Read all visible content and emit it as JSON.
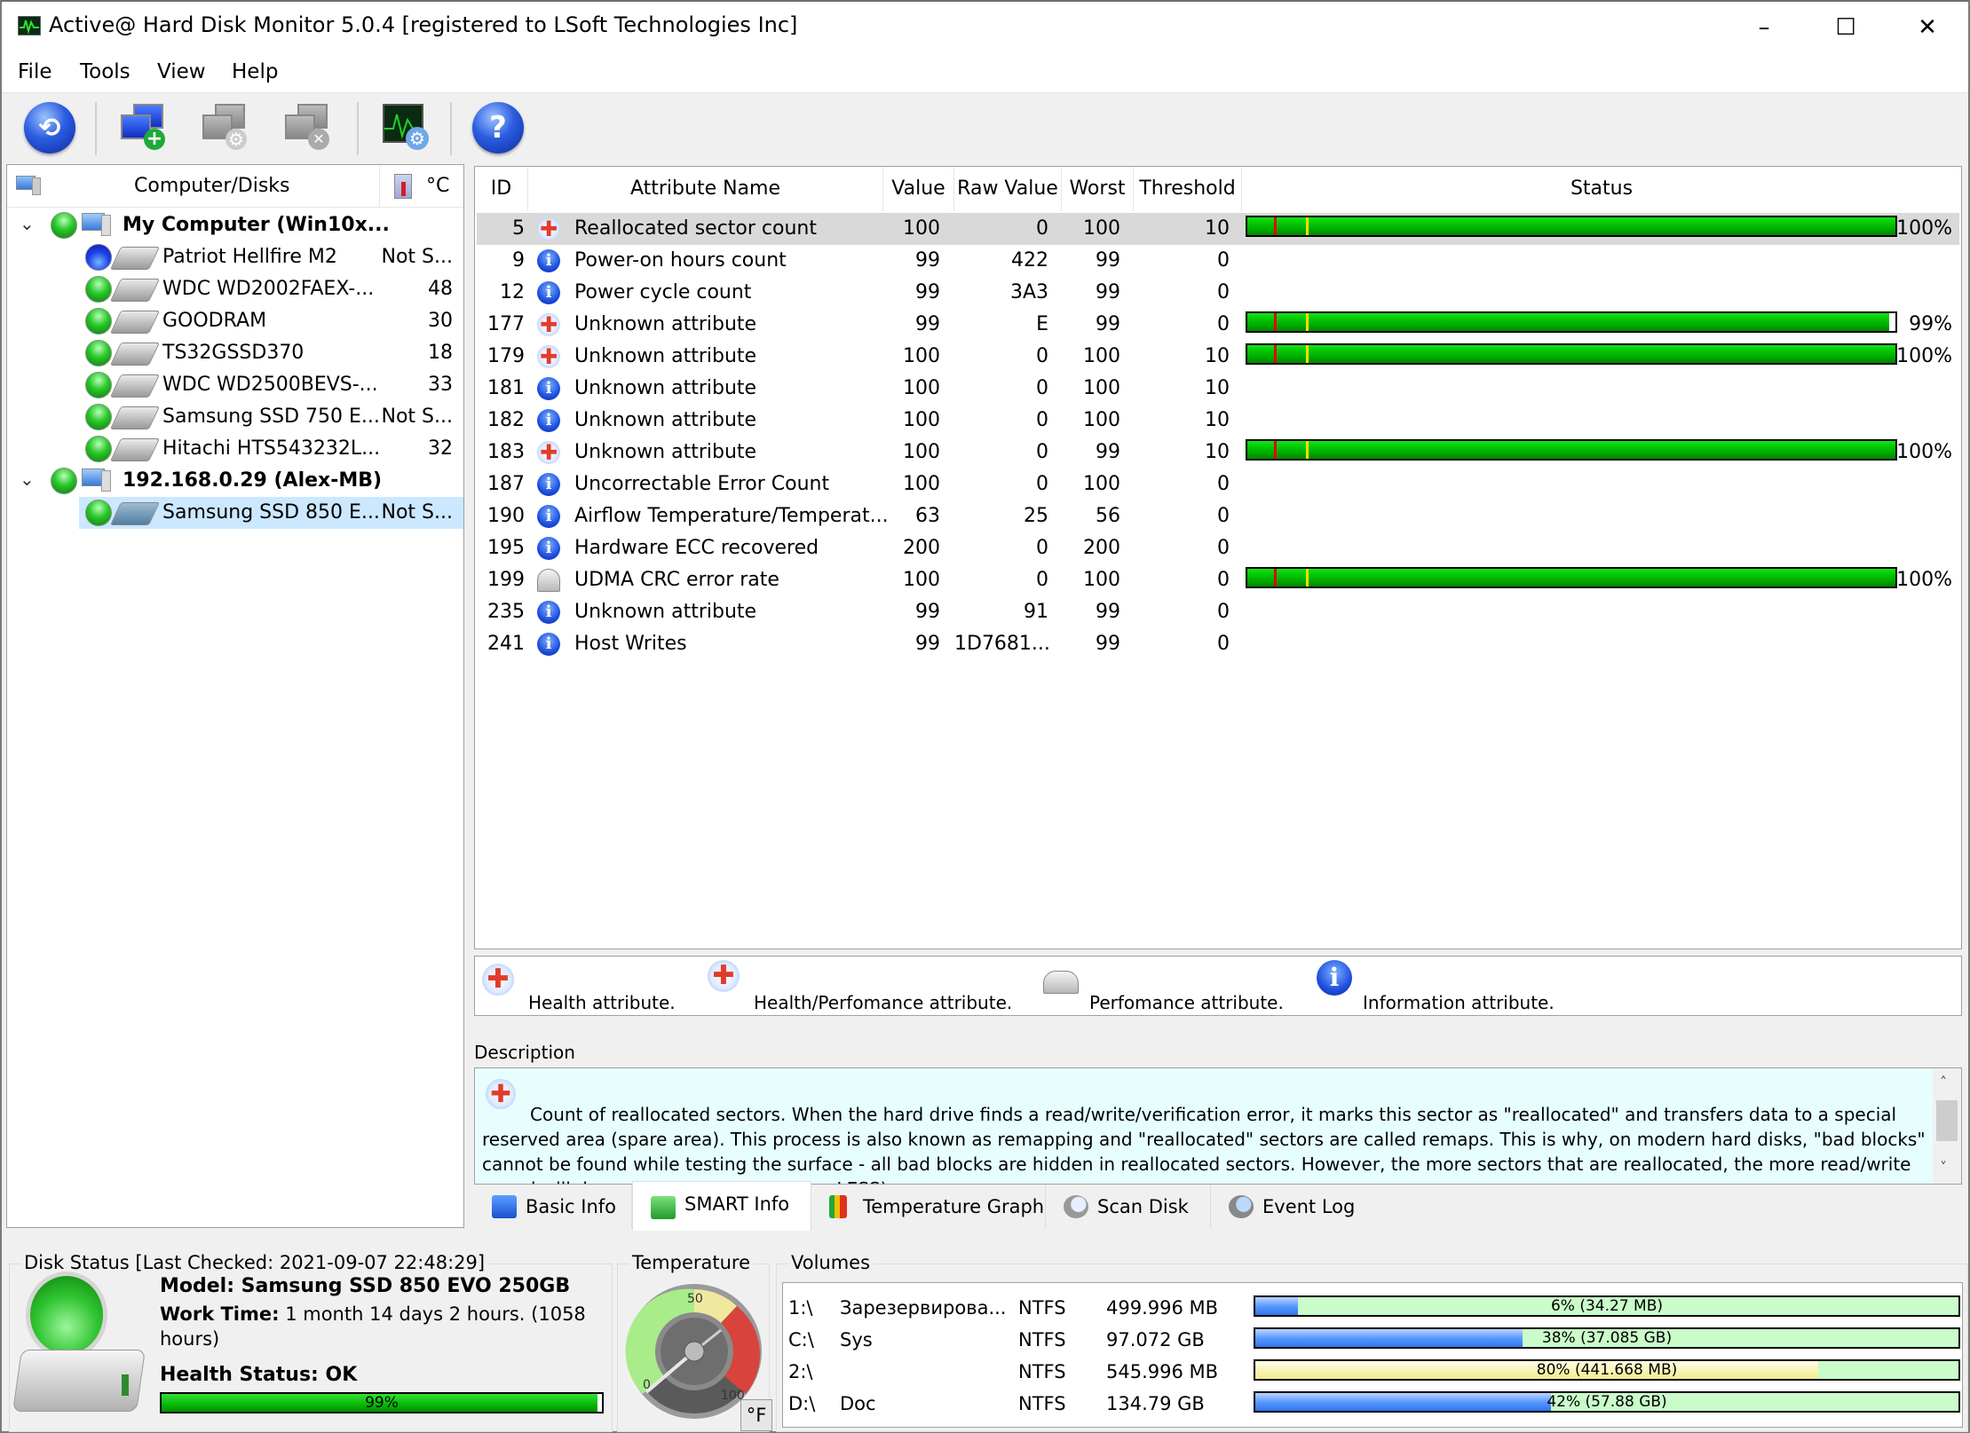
{
  "window": {
    "title": "Active@ Hard Disk Monitor 5.0.4 [registered to LSoft Technologies Inc]",
    "controls": {
      "minimize": "–",
      "maximize": "☐",
      "close": "✕"
    }
  },
  "menu": [
    "File",
    "Tools",
    "View",
    "Help"
  ],
  "toolbar": [
    {
      "name": "refresh-icon",
      "tooltip": "Refresh"
    },
    {
      "name": "add-computer-icon",
      "tooltip": "Add computer"
    },
    {
      "name": "computer-settings-icon",
      "tooltip": "Computer settings"
    },
    {
      "name": "remove-computer-icon",
      "tooltip": "Remove computer"
    },
    {
      "name": "monitor-settings-icon",
      "tooltip": "Settings"
    },
    {
      "name": "help-icon",
      "tooltip": "Help"
    }
  ],
  "tree": {
    "header": {
      "title": "Computer/Disks",
      "temp_unit": "°C"
    },
    "computers": [
      {
        "name": "My Computer (Win10x...",
        "status": "ok",
        "disks": [
          {
            "name": "Patriot Hellfire M2",
            "temp": "Not S...",
            "status": "blue"
          },
          {
            "name": "WDC WD2002FAEX-...",
            "temp": "48",
            "status": "ok"
          },
          {
            "name": "GOODRAM",
            "temp": "30",
            "status": "ok"
          },
          {
            "name": "TS32GSSD370",
            "temp": "18",
            "status": "ok"
          },
          {
            "name": "WDC WD2500BEVS-...",
            "temp": "33",
            "status": "ok"
          },
          {
            "name": "Samsung SSD 750 E...",
            "temp": "Not S...",
            "status": "ok"
          },
          {
            "name": "Hitachi HTS543232L...",
            "temp": "32",
            "status": "ok"
          }
        ]
      },
      {
        "name": "192.168.0.29 (Alex-MB)",
        "status": "ok",
        "disks": [
          {
            "name": "Samsung SSD 850 E...",
            "temp": "Not S...",
            "status": "ok",
            "selected": true
          }
        ]
      }
    ]
  },
  "smart": {
    "columns": [
      "ID",
      "Attribute Name",
      "Value",
      "Raw Value",
      "Worst",
      "Threshold",
      "Status"
    ],
    "rows": [
      {
        "id": "5",
        "type": "health",
        "name": "Reallocated sector count",
        "value": "100",
        "raw": "0",
        "worst": "100",
        "threshold": "10",
        "status_pct": 100,
        "status": "100%",
        "selected": true
      },
      {
        "id": "9",
        "type": "info",
        "name": "Power-on hours count",
        "value": "99",
        "raw": "422",
        "worst": "99",
        "threshold": "0"
      },
      {
        "id": "12",
        "type": "info",
        "name": "Power cycle count",
        "value": "99",
        "raw": "3A3",
        "worst": "99",
        "threshold": "0"
      },
      {
        "id": "177",
        "type": "health",
        "name": "Unknown attribute",
        "value": "99",
        "raw": "E",
        "worst": "99",
        "threshold": "0",
        "status_pct": 99,
        "status": "99%"
      },
      {
        "id": "179",
        "type": "health",
        "name": "Unknown attribute",
        "value": "100",
        "raw": "0",
        "worst": "100",
        "threshold": "10",
        "status_pct": 100,
        "status": "100%"
      },
      {
        "id": "181",
        "type": "info",
        "name": "Unknown attribute",
        "value": "100",
        "raw": "0",
        "worst": "100",
        "threshold": "10"
      },
      {
        "id": "182",
        "type": "info",
        "name": "Unknown attribute",
        "value": "100",
        "raw": "0",
        "worst": "100",
        "threshold": "10"
      },
      {
        "id": "183",
        "type": "health",
        "name": "Unknown attribute",
        "value": "100",
        "raw": "0",
        "worst": "99",
        "threshold": "10",
        "status_pct": 100,
        "status": "100%"
      },
      {
        "id": "187",
        "type": "info",
        "name": "Uncorrectable Error Count",
        "value": "100",
        "raw": "0",
        "worst": "100",
        "threshold": "0"
      },
      {
        "id": "190",
        "type": "info",
        "name": "Airflow Temperature/Temperat...",
        "value": "63",
        "raw": "25",
        "worst": "56",
        "threshold": "0"
      },
      {
        "id": "195",
        "type": "info",
        "name": "Hardware ECC recovered",
        "value": "200",
        "raw": "0",
        "worst": "200",
        "threshold": "0"
      },
      {
        "id": "199",
        "type": "perf",
        "name": "UDMA CRC error rate",
        "value": "100",
        "raw": "0",
        "worst": "100",
        "threshold": "0",
        "status_pct": 100,
        "status": "100%"
      },
      {
        "id": "235",
        "type": "info",
        "name": "Unknown attribute",
        "value": "99",
        "raw": "91",
        "worst": "99",
        "threshold": "0"
      },
      {
        "id": "241",
        "type": "info",
        "name": "Host Writes",
        "value": "99",
        "raw": "1D7681...",
        "worst": "99",
        "threshold": "0"
      }
    ],
    "marker_colors": {
      "critical": "#e00000",
      "warning": "#f0e000"
    },
    "bar_color": "#00c000"
  },
  "legend": [
    {
      "type": "health",
      "label": "Health attribute."
    },
    {
      "type": "health-perf",
      "label": "Health/Perfomance attribute."
    },
    {
      "type": "perf",
      "label": "Perfomance attribute."
    },
    {
      "type": "info",
      "label": "Information attribute."
    }
  ],
  "description": {
    "label": "Description",
    "text": "Count of reallocated sectors. When the hard drive finds a read/write/verification error, it marks this sector as \"reallocated\" and transfers data to a special reserved area (spare area). This process is also known as remapping and \"reallocated\" sectors are called remaps. This is why, on modern hard disks, \"bad blocks\" cannot be found while testing the surface - all bad blocks are hidden in reallocated sectors. However, the more sectors that are reallocated, the more read/write speed will decrease. (Better RAW Value LESS)"
  },
  "tabs": [
    {
      "label": "Basic Info",
      "icon": "blue-book-icon"
    },
    {
      "label": "SMART Info",
      "icon": "green-book-icon",
      "active": true
    },
    {
      "label": "Temperature Graph",
      "icon": "bar-chart-icon"
    },
    {
      "label": "Scan Disk",
      "icon": "magnifier-icon"
    },
    {
      "label": "Event Log",
      "icon": "log-search-icon"
    }
  ],
  "disk_status": {
    "title": "Disk Status [Last Checked: 2021-09-07 22:48:29]",
    "model_label": "Model: Samsung SSD 850 EVO 250GB",
    "work_time_label": "Work Time:",
    "work_time_value": "1 month 14 days 2 hours. (1058 hours)",
    "health_label": "Health Status: OK",
    "health_pct": 99,
    "health_text": "99%"
  },
  "temperature": {
    "title": "Temperature",
    "scale_labels": [
      "0",
      "50",
      "100"
    ],
    "unit_button": "°F"
  },
  "volumes": {
    "title": "Volumes",
    "rows": [
      {
        "drive": "1:\\",
        "label": "Зарезервирова...",
        "fs": "NTFS",
        "size": "499.996 MB",
        "used_pct": 6,
        "usage": "6% (34.27 MB)",
        "bar": "blue"
      },
      {
        "drive": "C:\\",
        "label": "Sys",
        "fs": "NTFS",
        "size": "97.072 GB",
        "used_pct": 38,
        "usage": "38% (37.085 GB)",
        "bar": "blue"
      },
      {
        "drive": "2:\\",
        "label": "",
        "fs": "NTFS",
        "size": "545.996 MB",
        "used_pct": 80,
        "usage": "80% (441.668 MB)",
        "bar": "yellow"
      },
      {
        "drive": "D:\\",
        "label": "Doc",
        "fs": "NTFS",
        "size": "134.79 GB",
        "used_pct": 42,
        "usage": "42% (57.88 GB)",
        "bar": "blue"
      }
    ]
  }
}
